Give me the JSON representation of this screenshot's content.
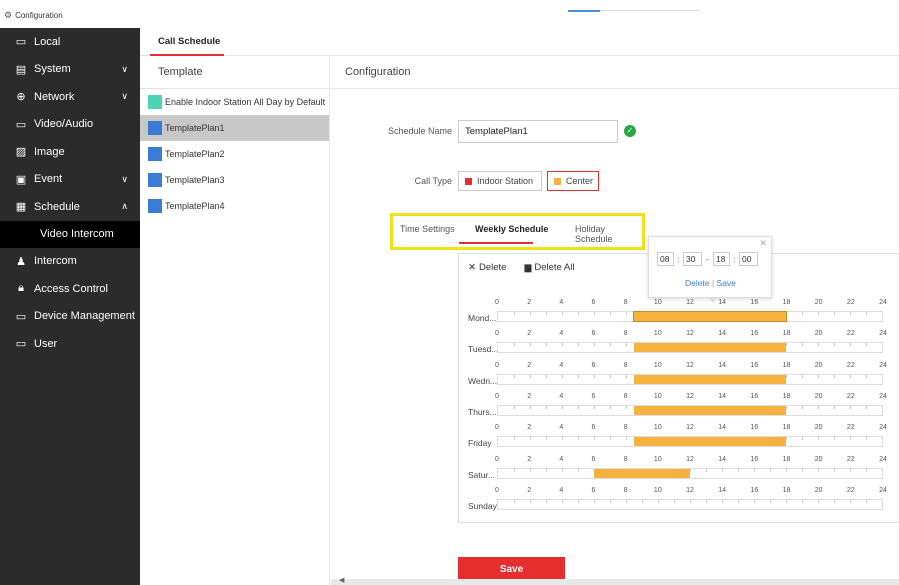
{
  "app": {
    "title": "Configuration"
  },
  "sidebar": {
    "items": [
      {
        "label": "Local",
        "icon": "monitor-icon",
        "chevron": ""
      },
      {
        "label": "System",
        "icon": "window-icon",
        "chevron": "down"
      },
      {
        "label": "Network",
        "icon": "globe-icon",
        "chevron": "down"
      },
      {
        "label": "Video/Audio",
        "icon": "camera-icon",
        "chevron": ""
      },
      {
        "label": "Image",
        "icon": "image-icon",
        "chevron": ""
      },
      {
        "label": "Event",
        "icon": "calendar-icon",
        "chevron": "down"
      },
      {
        "label": "Schedule",
        "icon": "schedule-icon",
        "chevron": "up"
      }
    ],
    "sub_item": "Video Intercom",
    "items_after": [
      {
        "label": "Intercom",
        "icon": "person-icon"
      },
      {
        "label": "Access Control",
        "icon": "lock-icon"
      },
      {
        "label": "Device Management",
        "icon": "monitor-icon"
      },
      {
        "label": "User",
        "icon": "monitor-icon"
      }
    ]
  },
  "tabs": {
    "active": "Call Schedule"
  },
  "template_panel": {
    "header": "Template",
    "items": [
      {
        "label": "Enable Indoor Station All Day by Default",
        "color": "#4fd1b5"
      },
      {
        "label": "TemplatePlan1",
        "color": "#3a7bd5",
        "active": true
      },
      {
        "label": "TemplatePlan2",
        "color": "#3a7bd5"
      },
      {
        "label": "TemplatePlan3",
        "color": "#3a7bd5"
      },
      {
        "label": "TemplatePlan4",
        "color": "#3a7bd5"
      }
    ]
  },
  "config": {
    "header": "Configuration",
    "schedule_name_label": "Schedule Name",
    "schedule_name_value": "TemplatePlan1",
    "call_type_label": "Call Type",
    "call_types": [
      {
        "label": "Indoor Station",
        "color": "#e52e2e",
        "selected": false
      },
      {
        "label": "Center",
        "color": "#f5b23f",
        "selected": true
      }
    ]
  },
  "subtabs": {
    "time_settings": "Time Settings",
    "weekly_schedule": "Weekly Schedule",
    "holiday_schedule": "Holiday Schedule"
  },
  "schedule": {
    "delete_label": "Delete",
    "delete_all_label": "Delete All",
    "hours": [
      "0",
      "2",
      "4",
      "6",
      "8",
      "10",
      "12",
      "14",
      "16",
      "18",
      "20",
      "22",
      "24"
    ],
    "days": [
      {
        "label": "Mond...",
        "start": 8.5,
        "end": 18.0,
        "selected": true
      },
      {
        "label": "Tuesd...",
        "start": 8.5,
        "end": 18.0
      },
      {
        "label": "Wedn...",
        "start": 8.5,
        "end": 18.0
      },
      {
        "label": "Thurs...",
        "start": 8.5,
        "end": 18.0
      },
      {
        "label": "Friday",
        "start": 8.5,
        "end": 18.0
      },
      {
        "label": "Satur...",
        "start": 6.0,
        "end": 12.0
      },
      {
        "label": "Sunday",
        "start": null,
        "end": null
      }
    ],
    "bar_color": "#f5b23f"
  },
  "popup": {
    "start_hour": "08",
    "start_min": "30",
    "end_hour": "18",
    "end_min": "00",
    "delete_link": "Delete",
    "save_link": "Save"
  },
  "save_button": "Save"
}
